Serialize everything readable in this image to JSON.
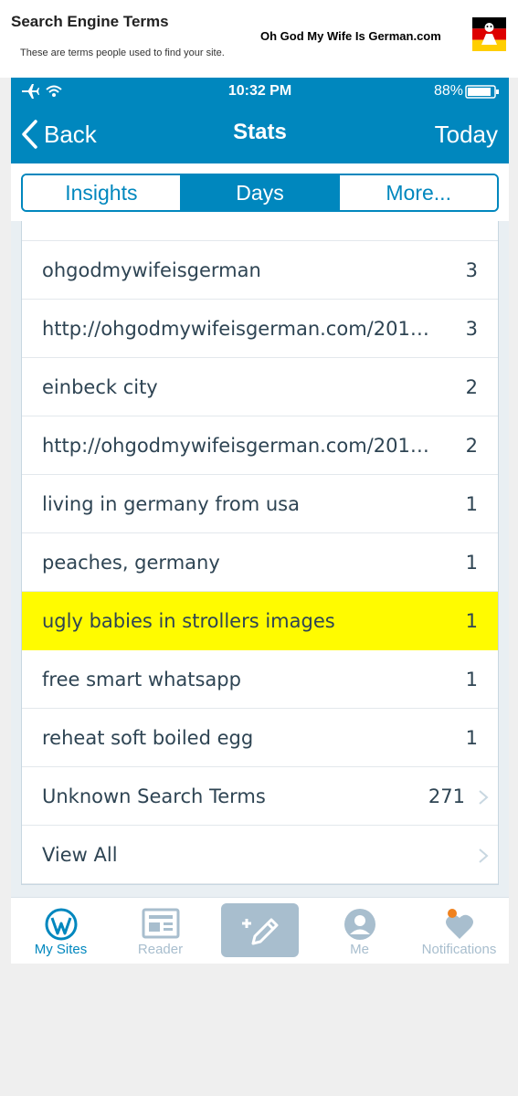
{
  "header": {
    "title": "Search Engine Terms",
    "subtitle": "These are terms people used to find your site.",
    "brand": "Oh God My Wife Is German.com"
  },
  "status_bar": {
    "time": "10:32 PM",
    "battery": "88%"
  },
  "nav": {
    "back_label": "Back",
    "title": "Stats",
    "right_label": "Today"
  },
  "tabs_segment": [
    {
      "label": "Insights",
      "active": false
    },
    {
      "label": "Days",
      "active": true
    },
    {
      "label": "More..."
    }
  ],
  "terms": [
    {
      "term": "ohgodmywifeisgerman",
      "count": "3"
    },
    {
      "term": "http://ohgodmywifeisgerman.com/2015/0...",
      "count": "3"
    },
    {
      "term": "einbeck city",
      "count": "2"
    },
    {
      "term": "http://ohgodmywifeisgerman.com/2015/0...",
      "count": "2"
    },
    {
      "term": "living in germany from usa",
      "count": "1"
    },
    {
      "term": "peaches, germany",
      "count": "1"
    },
    {
      "term": "ugly babies in strollers images",
      "count": "1",
      "highlighted": true
    },
    {
      "term": "free smart whatsapp",
      "count": "1"
    },
    {
      "term": "reheat soft boiled egg",
      "count": "1"
    }
  ],
  "unknown": {
    "label": "Unknown Search Terms",
    "count": "271"
  },
  "view_all": {
    "label": "View All"
  },
  "tab_bar": {
    "my_sites": "My Sites",
    "reader": "Reader",
    "me": "Me",
    "notifications": "Notifications"
  },
  "colors": {
    "accent": "#0087be",
    "highlight": "#fffb00",
    "tab_inactive": "#a8bece",
    "notification_dot": "#f0821e"
  }
}
